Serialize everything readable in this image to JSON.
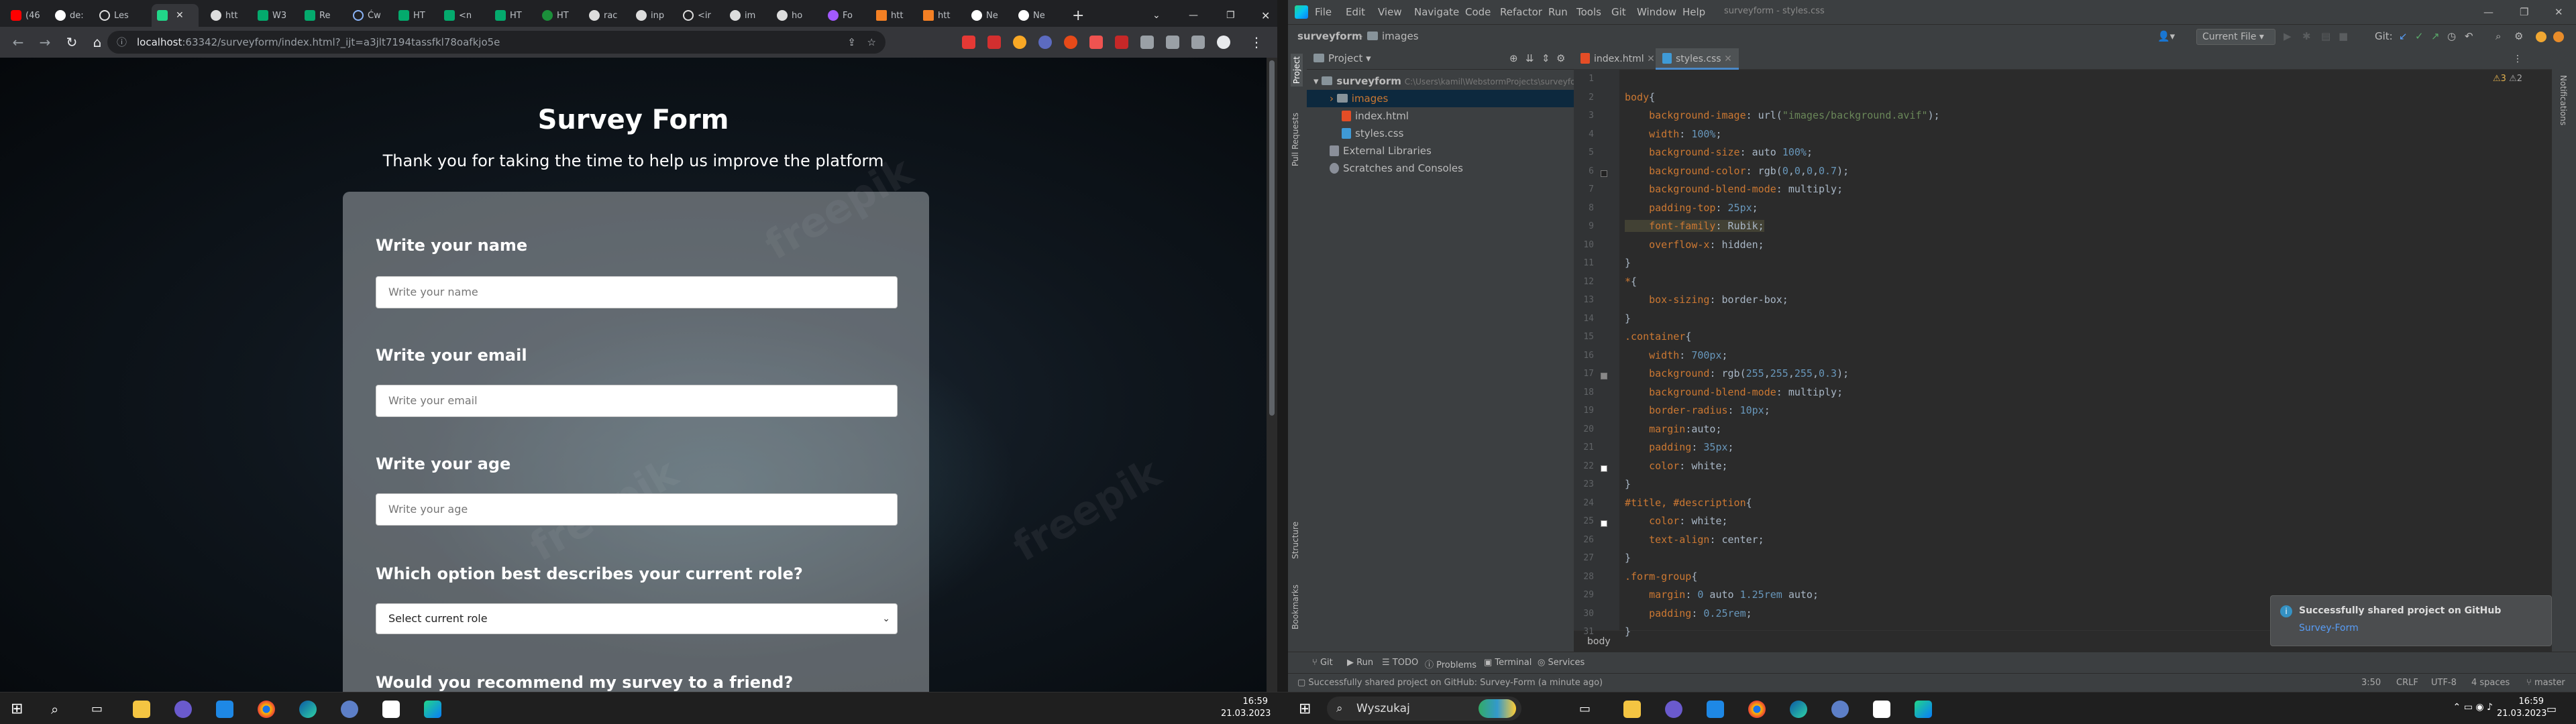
{
  "browser": {
    "tabs": [
      {
        "label": "(46"
      },
      {
        "label": "de:"
      },
      {
        "label": "Les"
      },
      {
        "label": ""
      },
      {
        "label": "htt"
      },
      {
        "label": "W3"
      },
      {
        "label": "Re"
      },
      {
        "label": "Ćw"
      },
      {
        "label": "HT"
      },
      {
        "label": "<n"
      },
      {
        "label": "HT"
      },
      {
        "label": "HT"
      },
      {
        "label": "rac"
      },
      {
        "label": "inp"
      },
      {
        "label": "<ir"
      },
      {
        "label": "im"
      },
      {
        "label": "ho"
      },
      {
        "label": "Fo"
      },
      {
        "label": "htt"
      },
      {
        "label": "htt"
      },
      {
        "label": "Ne"
      },
      {
        "label": "Ne"
      }
    ],
    "url_host": "localhost",
    "url_path": ":63342/surveyform/index.html?_ijt=a3jlt7194tassfkl78oafkjo5e",
    "new_tab": "+"
  },
  "page": {
    "title": "Survey Form",
    "description": "Thank you for taking the time to help us improve the platform",
    "fields": {
      "name_label": "Write your name",
      "name_placeholder": "Write your name",
      "email_label": "Write your email",
      "email_placeholder": "Write your email",
      "age_label": "Write your age",
      "age_placeholder": "Write your age",
      "role_label": "Which option best describes your current role?",
      "role_selected": "Select current role",
      "recommend_label": "Would you recommend my survey to a friend?"
    },
    "watermark": "freepik"
  },
  "ide": {
    "menu": [
      "File",
      "Edit",
      "View",
      "Navigate",
      "Code",
      "Refactor",
      "Run",
      "Tools",
      "Git",
      "Window",
      "Help"
    ],
    "window_title": "surveyform - styles.css",
    "breadcrumb_project": "surveyform",
    "breadcrumb_folder": "images",
    "run_config": "Current File",
    "git_label": "Git:",
    "project_panel_label": "Project",
    "tree": {
      "root": "surveyform",
      "root_path": "C:\\Users\\kamil\\WebstormProjects\\surveyform",
      "images": "images",
      "index": "index.html",
      "styles": "styles.css",
      "ext_libs": "External Libraries",
      "scratches": "Scratches and Consoles"
    },
    "editor_tabs": [
      "index.html",
      "styles.css"
    ],
    "inspections": {
      "warnings": "3",
      "weak": "2"
    },
    "code_lines": [
      "",
      "body{",
      "    background-image: url(\"images/background.avif\");",
      "    width: 100%;",
      "    background-size: auto 100%;",
      "    background-color: rgb(0,0,0,0.7);",
      "    background-blend-mode: multiply;",
      "    padding-top: 25px;",
      "    font-family: Rubik;",
      "    overflow-x: hidden;",
      "}",
      "*{",
      "    box-sizing: border-box;",
      "}",
      ".container{",
      "    width: 700px;",
      "    background: rgb(255,255,255,0.3);",
      "    background-blend-mode: multiply;",
      "    border-radius: 10px;",
      "    margin:auto;",
      "    padding: 35px;",
      "    color: white;",
      "}",
      "#title, #description{",
      "    color: white;",
      "    text-align: center;",
      "}",
      ".form-group{",
      "    margin: 0 auto 1.25rem auto;",
      "    padding: 0.25rem;",
      "}"
    ],
    "editor_breadcrumb": "body",
    "side_tools": [
      "Project",
      "Pull Requests",
      "Structure",
      "Bookmarks"
    ],
    "right_tools": [
      "Notifications"
    ],
    "bottom_tools": [
      "Git",
      "Run",
      "TODO",
      "Problems",
      "Terminal",
      "Services"
    ],
    "status_message": "Successfully shared project on GitHub: Survey-Form (a minute ago)",
    "status_right": [
      "3:50",
      "CRLF",
      "UTF-8",
      "4 spaces",
      "master"
    ],
    "notification": {
      "title": "Successfully shared project on GitHub",
      "link": "Survey-Form"
    }
  },
  "taskbar": {
    "time": "16:59",
    "date": "21.03.2023",
    "search_placeholder": "Wyszukaj"
  }
}
